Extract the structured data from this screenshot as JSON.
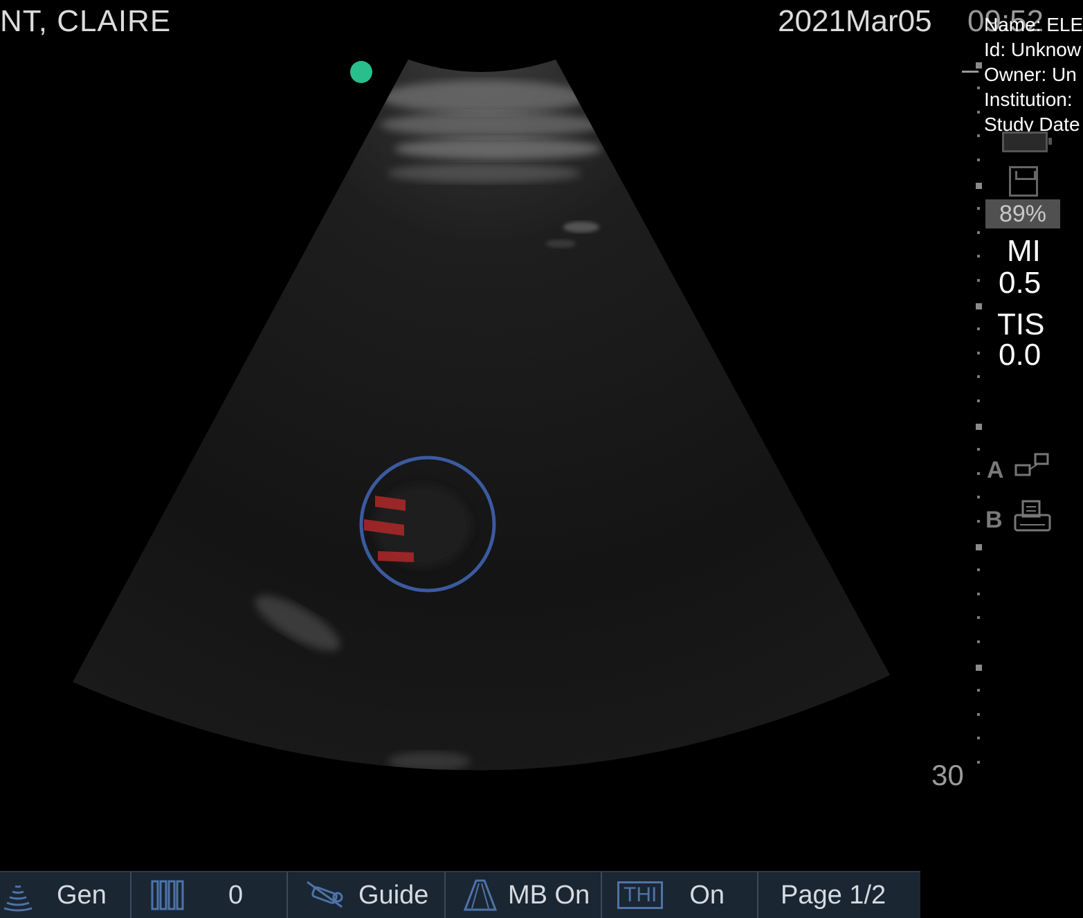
{
  "header": {
    "patient": "NT, CLAIRE",
    "date": "2021Mar05",
    "time": "09:52"
  },
  "meta": {
    "name": "Name: ELE",
    "id": "Id: Unknow",
    "owner": "Owner: Un",
    "institution": "Institution:",
    "study_date": "Study Date"
  },
  "right_panel": {
    "battery_percent": "89%",
    "mi_label": "MI",
    "mi_value": "0.5",
    "tis_label": "TIS",
    "tis_value": "0.0",
    "a_label": "A",
    "b_label": "B",
    "depth_max": "30"
  },
  "bottom_bar": {
    "preset": "Gen",
    "gain_value": "0",
    "guide": "Guide",
    "mb": "MB On",
    "thi_label": "THI",
    "thi_value": "On",
    "page": "Page 1/2"
  },
  "colors": {
    "orientation_marker": "#29bf8c",
    "circle_annotation": "#3b5aa0",
    "arrow_marks": "#b0282a",
    "toolbar_bg": "#1b2633"
  }
}
